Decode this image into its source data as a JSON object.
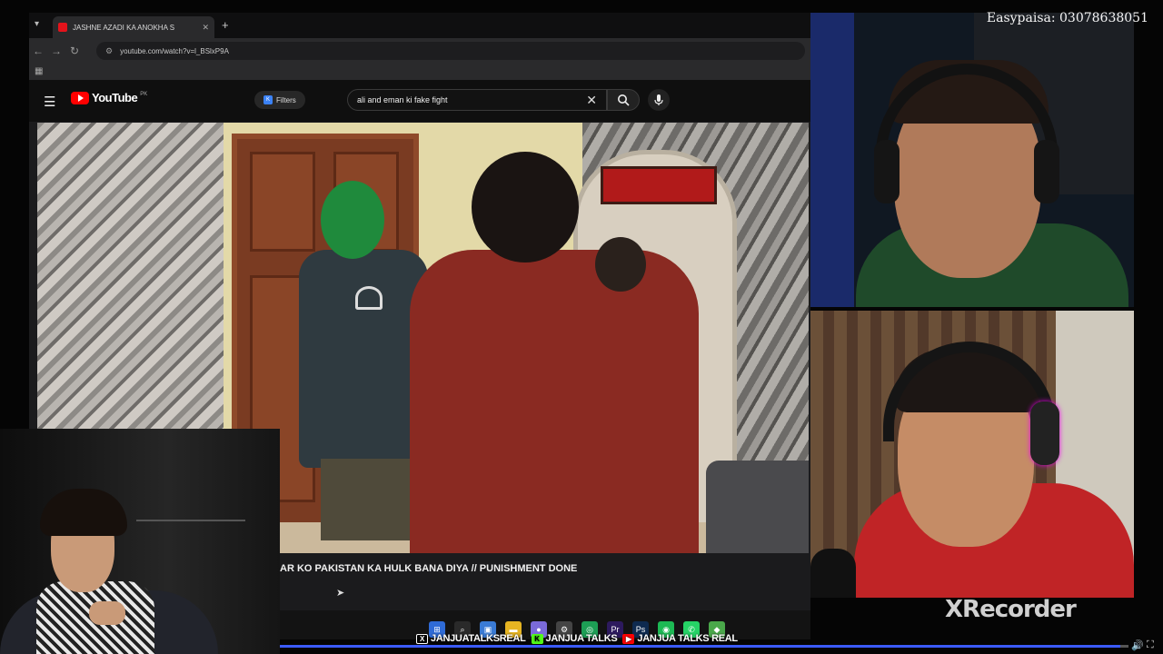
{
  "overlay": {
    "easypaisa": "Easypaisa: 03078638051",
    "watermark": "XRecorder",
    "socials": [
      {
        "icon": "x-icon",
        "label": "JANJUATALKSREAL"
      },
      {
        "icon": "kick-icon",
        "label": "JANJUA TALKS"
      },
      {
        "icon": "youtube-icon",
        "label": "JANJUA TALKS REAL"
      }
    ],
    "progress": 0.99
  },
  "browser": {
    "tab_title": "JASHNE AZADI KA ANOKHA S",
    "url": "youtube.com/watch?v=l_BSlxP9A",
    "youtube": {
      "logo": "YouTube",
      "logo_suffix": "PK",
      "filters_label": "Filters",
      "search_query": "ali and eman ki fake fight"
    },
    "video_title": "AR KO PAKISTAN KA HULK BANA DIYA // PUNISHMENT DONE",
    "taskbar_icons": [
      "windows-icon",
      "search-icon",
      "gallery-icon",
      "folder-icon",
      "app-icon",
      "settings-icon",
      "chrome-icon",
      "premiere-icon",
      "photoshop-icon",
      "spotify-icon",
      "whatsapp-icon",
      "maps-icon"
    ]
  },
  "colors": {
    "youtube_red": "#ff0000",
    "kick_green": "#53fc18",
    "progress_blue": "#3b5bff"
  }
}
